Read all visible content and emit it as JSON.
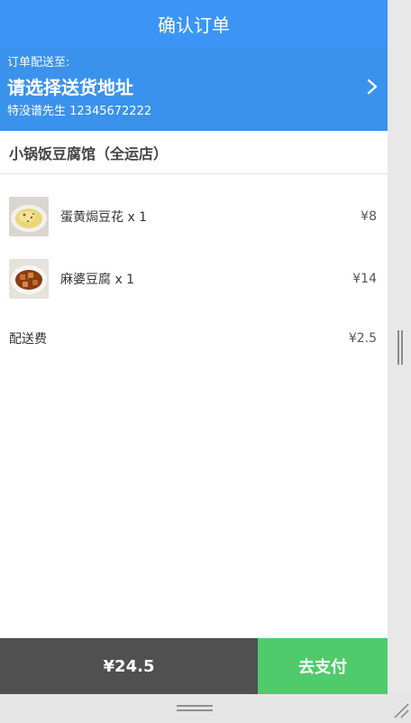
{
  "header": {
    "title": "确认订单"
  },
  "address": {
    "deliver_to_label": "订单配送至:",
    "select_prompt": "请选择送货地址",
    "contact": "特没谱先生 12345672222"
  },
  "shop": {
    "name": "小锅饭豆腐馆（全运店）"
  },
  "items": [
    {
      "name": "蛋黄焗豆花 x 1",
      "price": "¥8",
      "icon": "dish-thumbnail-icon"
    },
    {
      "name": "麻婆豆腐 x 1",
      "price": "¥14",
      "icon": "dish-thumbnail-icon"
    }
  ],
  "delivery_fee": {
    "label": "配送费",
    "price": "¥2.5"
  },
  "footer": {
    "total": "¥24.5",
    "pay_label": "去支付"
  },
  "colors": {
    "header": "#3b95f5",
    "address_bar": "#3a92ec",
    "total_bar": "#505050",
    "pay_button": "#4fcb6c"
  }
}
